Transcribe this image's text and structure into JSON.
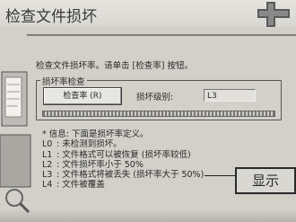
{
  "window": {
    "title": "检查文件损坏",
    "icon": "dialog-logo-icon"
  },
  "main": {
    "instruction": "检查文件损坏率。请单击 [检查率] 按钮。",
    "group": {
      "title": "损坏率检查",
      "check_button_label": "检查率 (R)",
      "level_label": "损坏级别:",
      "level_value": "L3"
    },
    "info": {
      "header": "* 信息: 下面是损坏率定义。",
      "items": [
        {
          "code": "L0",
          "text": ": 未检测到损坏。"
        },
        {
          "code": "L1",
          "text": ": 文件格式可以被恢复 (损坏率较低)"
        },
        {
          "code": "L2",
          "text": ": 文件损坏率小于 50%"
        },
        {
          "code": "L3",
          "text": ": 文件格式将被丢失 (损坏率大于 50%)"
        },
        {
          "code": "L4",
          "text": ": 文件被覆盖"
        }
      ]
    }
  },
  "callout": {
    "label": "显示"
  }
}
